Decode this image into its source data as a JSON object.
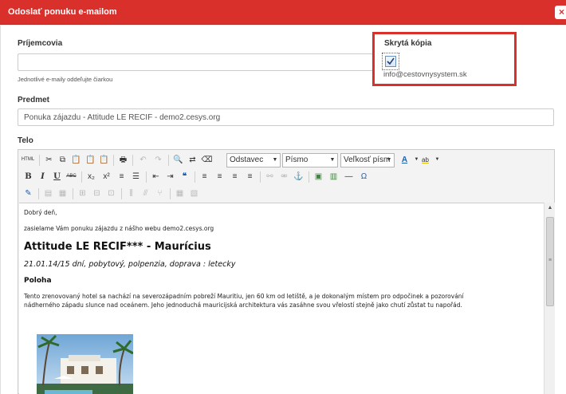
{
  "dialog": {
    "title": "Odoslať ponuku e-mailom",
    "close_label": "×"
  },
  "recipients": {
    "label": "Príjemcovia",
    "value": "",
    "hint": "Jednotlivé e-maily oddeľujte čiarkou"
  },
  "bcc": {
    "label": "Skrytá kópia",
    "checked": true,
    "email": "info@cestovnysystem.sk"
  },
  "subject": {
    "label": "Predmet",
    "value": "Ponuka zájazdu - Attitude LE RECIF - demo2.cesys.org"
  },
  "body": {
    "label": "Telo"
  },
  "toolbar": {
    "html_label": "HTML",
    "format_combo": "Odstavec",
    "font_combo": "Písmo",
    "size_combo": "Veľkosť písm",
    "bold": "B",
    "italic": "I",
    "underline": "U",
    "strike": "ABC",
    "subscript": "x₂",
    "superscript": "x²",
    "omega": "Ω",
    "text_color": "A",
    "bg_color": "ab"
  },
  "document": {
    "greeting": "Dobrý deň,",
    "intro": "zasielame Vám ponuku zájazdu z nášho webu demo2.cesys.org",
    "heading": "Attitude LE RECIF*** - Maurícius",
    "subheading": "21.01.14/15 dní, pobytový, polpenzia, doprava : letecky",
    "section": "Poloha",
    "paragraph": "Tento zrenovovaný hotel sa nachází na severozápadním pobreží Mauritiu, jen 60 km od letiště, a je dokonalým místem pro odpočinek a pozorování nádherného západu slunce nad oceánem. Jeho jednoduchá mauricijská architektura vás zasáhne svou vřelostí stejně jako chutí zůstat tu napořád."
  },
  "colors": {
    "accent": "#d9302c",
    "border": "#cccccc",
    "toolbar_bg": "#f3f3f3"
  }
}
